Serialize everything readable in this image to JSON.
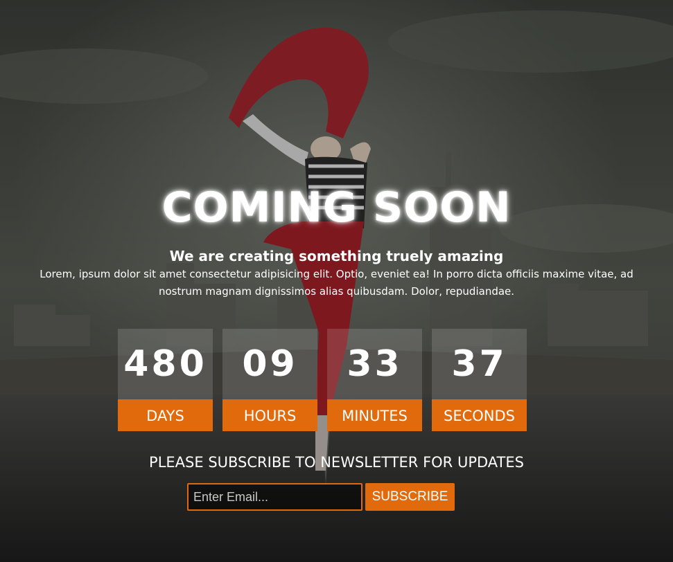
{
  "hero": {
    "title": "COMING SOON",
    "subtitle": "We are creating something truely amazing",
    "description": "Lorem, ipsum dolor sit amet consectetur adipisicing elit. Optio, eveniet ea! In porro dicta officiis maxime vitae, ad nostrum magnam dignissimos alias quibusdam. Dolor, repudiandae."
  },
  "countdown": [
    {
      "value": "480",
      "label": "DAYS"
    },
    {
      "value": "09",
      "label": "HOURS"
    },
    {
      "value": "33",
      "label": "MINUTES"
    },
    {
      "value": "37",
      "label": "SECONDS"
    }
  ],
  "newsletter": {
    "heading": "PLEASE SUBSCRIBE TO NEWSLETTER FOR UPDATES",
    "email_placeholder": "Enter Email...",
    "email_value": "",
    "button_label": "SUBSCRIBE"
  },
  "colors": {
    "accent": "#e06a0c"
  }
}
